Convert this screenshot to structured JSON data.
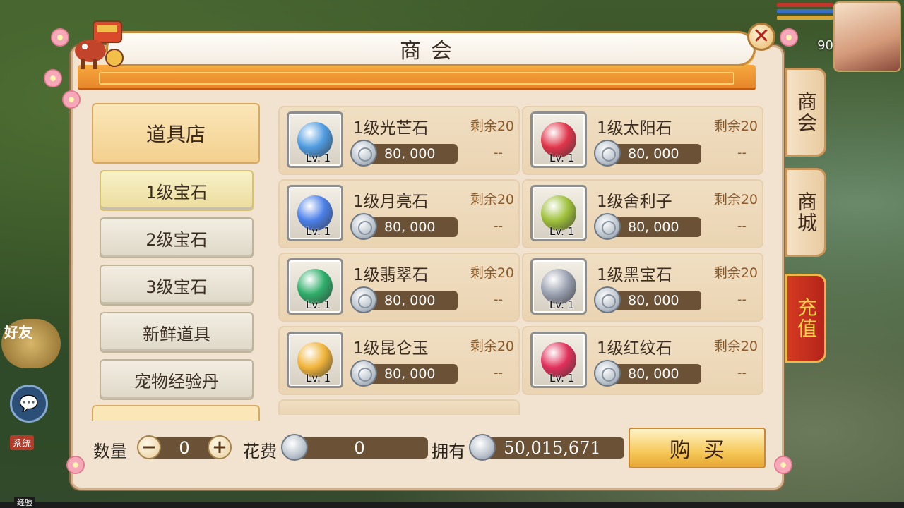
{
  "dialog": {
    "title": "商会",
    "close_icon": "close-icon"
  },
  "side_tabs": [
    {
      "label": "商会",
      "active": false
    },
    {
      "label": "商城",
      "active": false
    },
    {
      "label": "充值",
      "active": true
    }
  ],
  "category_header": "道具店",
  "categories": [
    {
      "label": "1级宝石",
      "selected": true
    },
    {
      "label": "2级宝石",
      "selected": false
    },
    {
      "label": "3级宝石",
      "selected": false
    },
    {
      "label": "新鲜道具",
      "selected": false
    },
    {
      "label": "宠物经验丹",
      "selected": false
    }
  ],
  "items": [
    {
      "name": "1级光芒石",
      "remain": "剩余20",
      "price": "80, 000",
      "dash": "--",
      "lv": "Lv. 1",
      "icon": "crystal-blue-icon",
      "color": "#4f9be0"
    },
    {
      "name": "1级太阳石",
      "remain": "剩余20",
      "price": "80, 000",
      "dash": "--",
      "lv": "Lv. 1",
      "icon": "sun-stone-icon",
      "color": "#e0344a"
    },
    {
      "name": "1级月亮石",
      "remain": "剩余20",
      "price": "80, 000",
      "dash": "--",
      "lv": "Lv. 1",
      "icon": "moon-stone-icon",
      "color": "#4b7fe8"
    },
    {
      "name": "1级舍利子",
      "remain": "剩余20",
      "price": "80, 000",
      "dash": "--",
      "lv": "Lv. 1",
      "icon": "relic-beads-icon",
      "color": "#9ec03a"
    },
    {
      "name": "1级翡翠石",
      "remain": "剩余20",
      "price": "80, 000",
      "dash": "--",
      "lv": "Lv. 1",
      "icon": "jade-stone-icon",
      "color": "#2fae6a"
    },
    {
      "name": "1级黑宝石",
      "remain": "剩余20",
      "price": "80, 000",
      "dash": "--",
      "lv": "Lv. 1",
      "icon": "black-gem-icon",
      "color": "#9aa0b0"
    },
    {
      "name": "1级昆仑玉",
      "remain": "剩余20",
      "price": "80, 000",
      "dash": "--",
      "lv": "Lv. 1",
      "icon": "kunlun-jade-icon",
      "color": "#f0b43a"
    },
    {
      "name": "1级红纹石",
      "remain": "剩余20",
      "price": "80, 000",
      "dash": "--",
      "lv": "Lv. 1",
      "icon": "red-stripe-stone-icon",
      "color": "#e0305a"
    }
  ],
  "bottom": {
    "qty_label": "数量",
    "qty_value": "0",
    "minus": "−",
    "plus": "+",
    "cost_label": "花费",
    "cost_value": "0",
    "own_label": "拥有",
    "own_value": "50,015,671",
    "buy_label": "购买"
  },
  "hud": {
    "level": "90",
    "friend_label": "好友",
    "system_tag": "系统",
    "exp_label": "经验"
  }
}
